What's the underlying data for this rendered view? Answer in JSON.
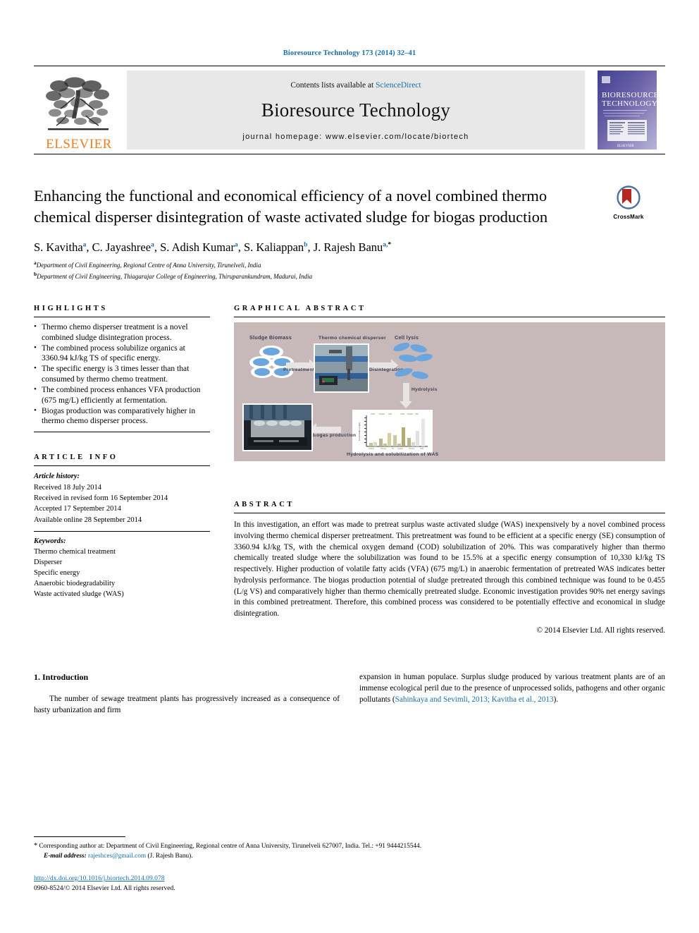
{
  "running_head": "Bioresource Technology 173 (2014) 32–41",
  "masthead": {
    "contents_prefix": "Contents lists available at ",
    "sciencedirect": "ScienceDirect",
    "journal_title": "Bioresource Technology",
    "homepage": "journal homepage: www.elsevier.com/locate/biortech",
    "publisher": "ELSEVIER",
    "cover_title_line1": "BIORESOURCE",
    "cover_title_line2": "TECHNOLOGY"
  },
  "article": {
    "title": "Enhancing the functional and economical efficiency of a novel combined thermo chemical disperser disintegration of waste activated sludge for biogas production",
    "crossmark_label": "CrossMark",
    "authors": [
      {
        "name": "S. Kavitha",
        "sup": "a",
        "sep": ", "
      },
      {
        "name": "C. Jayashree",
        "sup": "a",
        "sep": ", "
      },
      {
        "name": "S. Adish Kumar",
        "sup": "a",
        "sep": ", "
      },
      {
        "name": "S. Kaliappan",
        "sup": "b",
        "sep": ", "
      },
      {
        "name": "J. Rajesh Banu",
        "sup": "a,",
        "sep": ""
      }
    ],
    "affiliations": [
      {
        "marker": "a",
        "text": "Department of Civil Engineering, Regional Centre of Anna University, Tirunelveli, India"
      },
      {
        "marker": "b",
        "text": "Department of Civil Engineering, Thiagarajar College of Engineering, Thiruparankundram, Madurai, India"
      }
    ]
  },
  "highlights": {
    "heading": "HIGHLIGHTS",
    "items": [
      "Thermo chemo disperser treatment is a novel combined sludge disintegration process.",
      "The combined process solubilize organics at 3360.94 kJ/kg TS of specific energy.",
      "The specific energy is 3 times lesser than that consumed by thermo chemo treatment.",
      "The combined process enhances VFA production (675 mg/L) efficiently at fermentation.",
      "Biogas production was comparatively higher in thermo chemo disperser process."
    ]
  },
  "article_info": {
    "heading": "ARTICLE INFO",
    "history_label": "Article history:",
    "history": [
      "Received 18 July 2014",
      "Received in revised form 16 September 2014",
      "Accepted 17 September 2014",
      "Available online 28 September 2014"
    ],
    "keywords_label": "Keywords:",
    "keywords": [
      "Thermo chemical treatment",
      "Disperser",
      "Specific energy",
      "Anaerobic biodegradability",
      "Waste activated sludge (WAS)"
    ]
  },
  "graphical_abstract": {
    "heading": "GRAPHICAL ABSTRACT",
    "labels": {
      "sludge_biomass": "Sludge Biomass",
      "thermo_chemical_disperser": "Thermo chemical disperser",
      "cell_lysis": "Cell lysis",
      "pretreatment": "Pretreatment",
      "disintegration": "Disintegration",
      "hydrolysis": "Hydrolysis",
      "biogas_production": "Biogas production",
      "chart_caption": "Hydrolysis and solubilization of WAS"
    }
  },
  "abstract": {
    "heading": "ABSTRACT",
    "text": "In this investigation, an effort was made to pretreat surplus waste activated sludge (WAS) inexpensively by a novel combined process involving thermo chemical disperser pretreatment. This pretreatment was found to be efficient at a specific energy (SE) consumption of 3360.94 kJ/kg TS, with the chemical oxygen demand (COD) solubilization of 20%. This was comparatively higher than thermo chemically treated sludge where the solubilization was found to be 15.5% at a specific energy consumption of 10,330 kJ/kg TS respectively. Higher production of volatile fatty acids (VFA) (675 mg/L) in anaerobic fermentation of pretreated WAS indicates better hydrolysis performance. The biogas production potential of sludge pretreated through this combined technique was found to be 0.455 (L/g VS) and comparatively higher than thermo chemically pretreated sludge. Economic investigation provides 90% net energy savings in this combined pretreatment. Therefore, this combined process was considered to be potentially effective and economical in sludge disintegration.",
    "copyright": "© 2014 Elsevier Ltd. All rights reserved."
  },
  "introduction": {
    "number_title": "1. Introduction",
    "col1": "The number of sewage treatment plants has progressively increased as a consequence of hasty urbanization and firm",
    "col2_pre": "expansion in human populace. Surplus sludge produced by various treatment plants are of an immense ecological peril due to the presence of unprocessed solids, pathogens and other organic pollutants (",
    "col2_cite": "Sahinkaya and Sevimli, 2013; Kavitha et al., 2013",
    "col2_post": ")."
  },
  "footer": {
    "star": "*",
    "corresponding": "Corresponding author at: Department of Civil Engineering, Regional centre of Anna University, Tirunelveli 627007, India. Tel.: +91 9444215544.",
    "email_label": "E-mail address:",
    "email": "rajeshces@gmail.com",
    "email_suffix": "(J. Rajesh Banu).",
    "doi": "http://dx.doi.org/10.1016/j.biortech.2014.09.078",
    "issn_line": "0960-8524/© 2014 Elsevier Ltd. All rights reserved."
  },
  "colors": {
    "link_blue": "#1a6fa8",
    "elsevier_orange": "#f07d22",
    "masthead_grey": "#e8e8e8",
    "ga_background": "#c7b9b9"
  }
}
